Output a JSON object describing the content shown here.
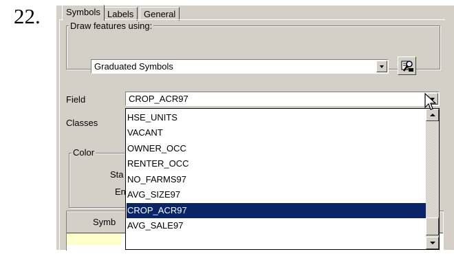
{
  "step_number": "22.",
  "tabs": [
    {
      "label": "Symbols",
      "active": true
    },
    {
      "label": "Labels",
      "active": false
    },
    {
      "label": "General",
      "active": false
    }
  ],
  "draw_group": {
    "label": "Draw features using:",
    "selected": "Graduated Symbols"
  },
  "field": {
    "label": "Field",
    "selected": "CROP_ACR97"
  },
  "classes": {
    "label": "Classes"
  },
  "color_group": {
    "label": "Color",
    "start_label": "Sta",
    "end_label": "En"
  },
  "symbol_table": {
    "header": "Symb"
  },
  "dropdown": {
    "items": [
      {
        "label": "HSE_UNITS"
      },
      {
        "label": "VACANT"
      },
      {
        "label": "OWNER_OCC"
      },
      {
        "label": "RENTER_OCC"
      },
      {
        "label": "NO_FARMS97"
      },
      {
        "label": "AVG_SIZE97"
      },
      {
        "label": "CROP_ACR97",
        "selected": true
      },
      {
        "label": "AVG_SALE97"
      }
    ]
  },
  "colors": {
    "face": "#d4d0c8",
    "selection": "#0a246a",
    "swatch": "#ffffcc"
  }
}
